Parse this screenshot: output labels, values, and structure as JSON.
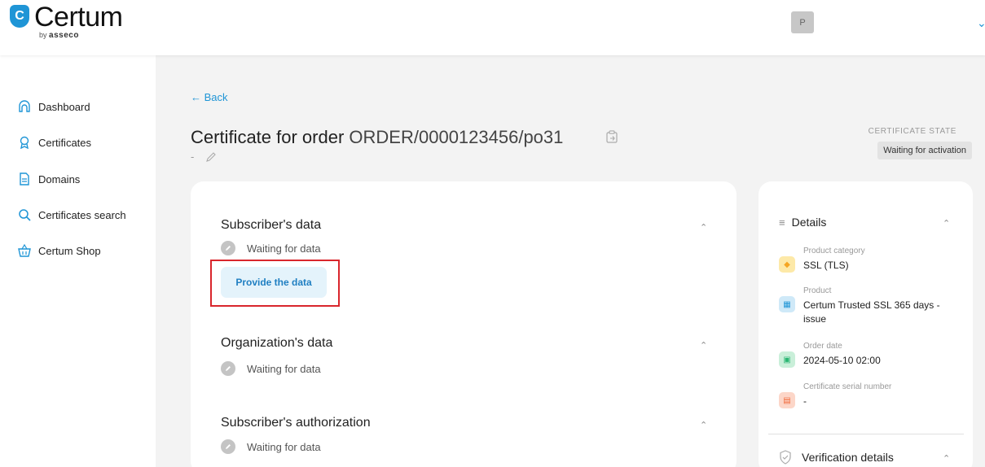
{
  "brand": {
    "name": "Certum",
    "by": "by",
    "company": "asseco"
  },
  "user": {
    "initial": "P"
  },
  "sidebar": {
    "items": [
      {
        "label": "Dashboard",
        "icon": "home-icon"
      },
      {
        "label": "Certificates",
        "icon": "certificate-icon"
      },
      {
        "label": "Domains",
        "icon": "document-icon"
      },
      {
        "label": "Certificates search",
        "icon": "search-icon"
      },
      {
        "label": "Certum Shop",
        "icon": "basket-icon"
      }
    ]
  },
  "page": {
    "back_label": "← Back",
    "title_prefix": "Certificate for order",
    "order_number": "ORDER/0000123456/po31",
    "subtitle": "-",
    "state_label": "CERTIFICATE STATE",
    "state_value": "Waiting for activation"
  },
  "sections": [
    {
      "title": "Subscriber's data",
      "status": "Waiting for data",
      "action": "Provide the data"
    },
    {
      "title": "Organization's data",
      "status": "Waiting for data"
    },
    {
      "title": "Subscriber's authorization",
      "status": "Waiting for data"
    }
  ],
  "details": {
    "title": "Details",
    "items": [
      {
        "label": "Product category",
        "value": "SSL (TLS)",
        "icon": "tag-icon",
        "color": "#f5a623"
      },
      {
        "label": "Product",
        "value": "Certum Trusted SSL 365 days - issue",
        "icon": "box-icon",
        "color": "#1f95d6"
      },
      {
        "label": "Order date",
        "value": "2024-05-10 02:00",
        "icon": "calendar-icon",
        "color": "#2bb673"
      },
      {
        "label": "Certificate serial number",
        "value": "-",
        "icon": "serial-icon",
        "color": "#f06a3c"
      }
    ],
    "verification_title": "Verification details"
  },
  "colors": {
    "accent": "#1f95d6",
    "highlight": "#d9262c",
    "background": "#f3f3f3"
  }
}
